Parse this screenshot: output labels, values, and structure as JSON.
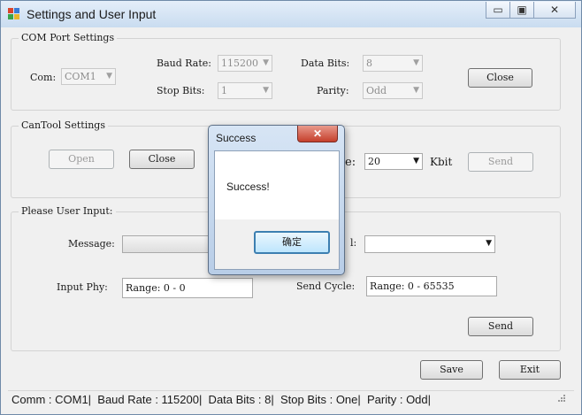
{
  "window": {
    "title": "Settings and User Input",
    "min_glyph": "▭",
    "max_glyph": "▣",
    "close_glyph": "✕"
  },
  "com_group": {
    "title": "COM Port Settings",
    "com_label": "Com:",
    "com_value": "COM1",
    "baud_label": "Baud Rate:",
    "baud_value": "115200",
    "databits_label": "Data Bits:",
    "databits_value": "8",
    "stopbits_label": "Stop Bits:",
    "stopbits_value": "1",
    "parity_label": "Parity:",
    "parity_value": "Odd",
    "close_button": "Close"
  },
  "cantool_group": {
    "title": "CanTool Settings",
    "open_button": "Open",
    "close_button": "Close",
    "rate_label_tail": "e:",
    "rate_value": "20",
    "rate_unit": "Kbit",
    "send_button": "Send"
  },
  "input_group": {
    "title": "Please User Input:",
    "message_label": "Message:",
    "message_value": "",
    "signal_label_tail": "l:",
    "signal_value": "",
    "phy_label": "Input Phy:",
    "phy_value": "Range: 0 - 0",
    "cycle_label": "Send Cycle:",
    "cycle_value": "Range: 0 - 65535",
    "send_button": "Send"
  },
  "footer": {
    "save_button": "Save",
    "exit_button": "Exit"
  },
  "statusbar": {
    "text": "Comm : COM1|  Baud Rate : 115200|  Data Bits : 8|  Stop Bits : One|  Parity : Odd|"
  },
  "dialog": {
    "title": "Success",
    "close_glyph": "✕",
    "message": "Success!",
    "ok_button": "确定"
  },
  "icons": {
    "dropdown": "▼"
  },
  "colors": {
    "accent": "#3c7fb1",
    "dialog_close": "#c5402c"
  }
}
